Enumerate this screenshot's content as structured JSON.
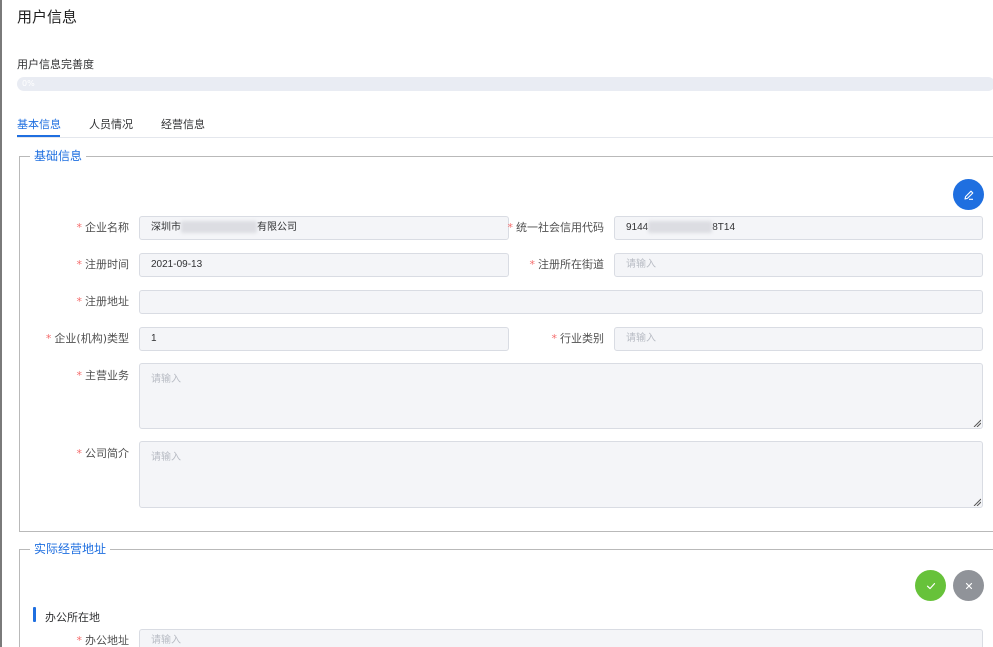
{
  "page": {
    "title": "用户信息"
  },
  "completeness": {
    "label": "用户信息完善度",
    "percent_text": "0%",
    "percent": 0
  },
  "tabs": [
    {
      "label": "基本信息",
      "active": true
    },
    {
      "label": "人员情况",
      "active": false
    },
    {
      "label": "经营信息",
      "active": false
    }
  ],
  "basic_info": {
    "legend": "基础信息",
    "fields": {
      "company_name": {
        "label": "企业名称",
        "value_prefix": "深圳市",
        "value_suffix": "有限公司"
      },
      "credit_code": {
        "label": "统一社会信用代码",
        "value_prefix": "9144",
        "value_suffix": "8T14"
      },
      "reg_time": {
        "label": "注册时间",
        "value": "2021-09-13"
      },
      "reg_street": {
        "label": "注册所在街道",
        "placeholder": "请输入"
      },
      "reg_address": {
        "label": "注册地址",
        "value": ""
      },
      "org_type": {
        "label": "企业(机构)类型",
        "value": "1"
      },
      "industry": {
        "label": "行业类别",
        "placeholder": "请输入"
      },
      "main_business": {
        "label": "主营业务",
        "placeholder": "请输入"
      },
      "company_intro": {
        "label": "公司简介",
        "placeholder": "请输入"
      }
    }
  },
  "address_info": {
    "legend": "实际经营地址",
    "section_title": "办公所在地",
    "fields": {
      "office_address": {
        "label": "办公地址",
        "placeholder": "请输入"
      }
    }
  },
  "colors": {
    "accent": "#1f6fe0",
    "required": "#f56c6c",
    "confirm": "#67c23a",
    "cancel": "#909399"
  },
  "icons": {
    "edit": "pencil-icon",
    "confirm": "check-icon",
    "cancel": "close-icon"
  }
}
